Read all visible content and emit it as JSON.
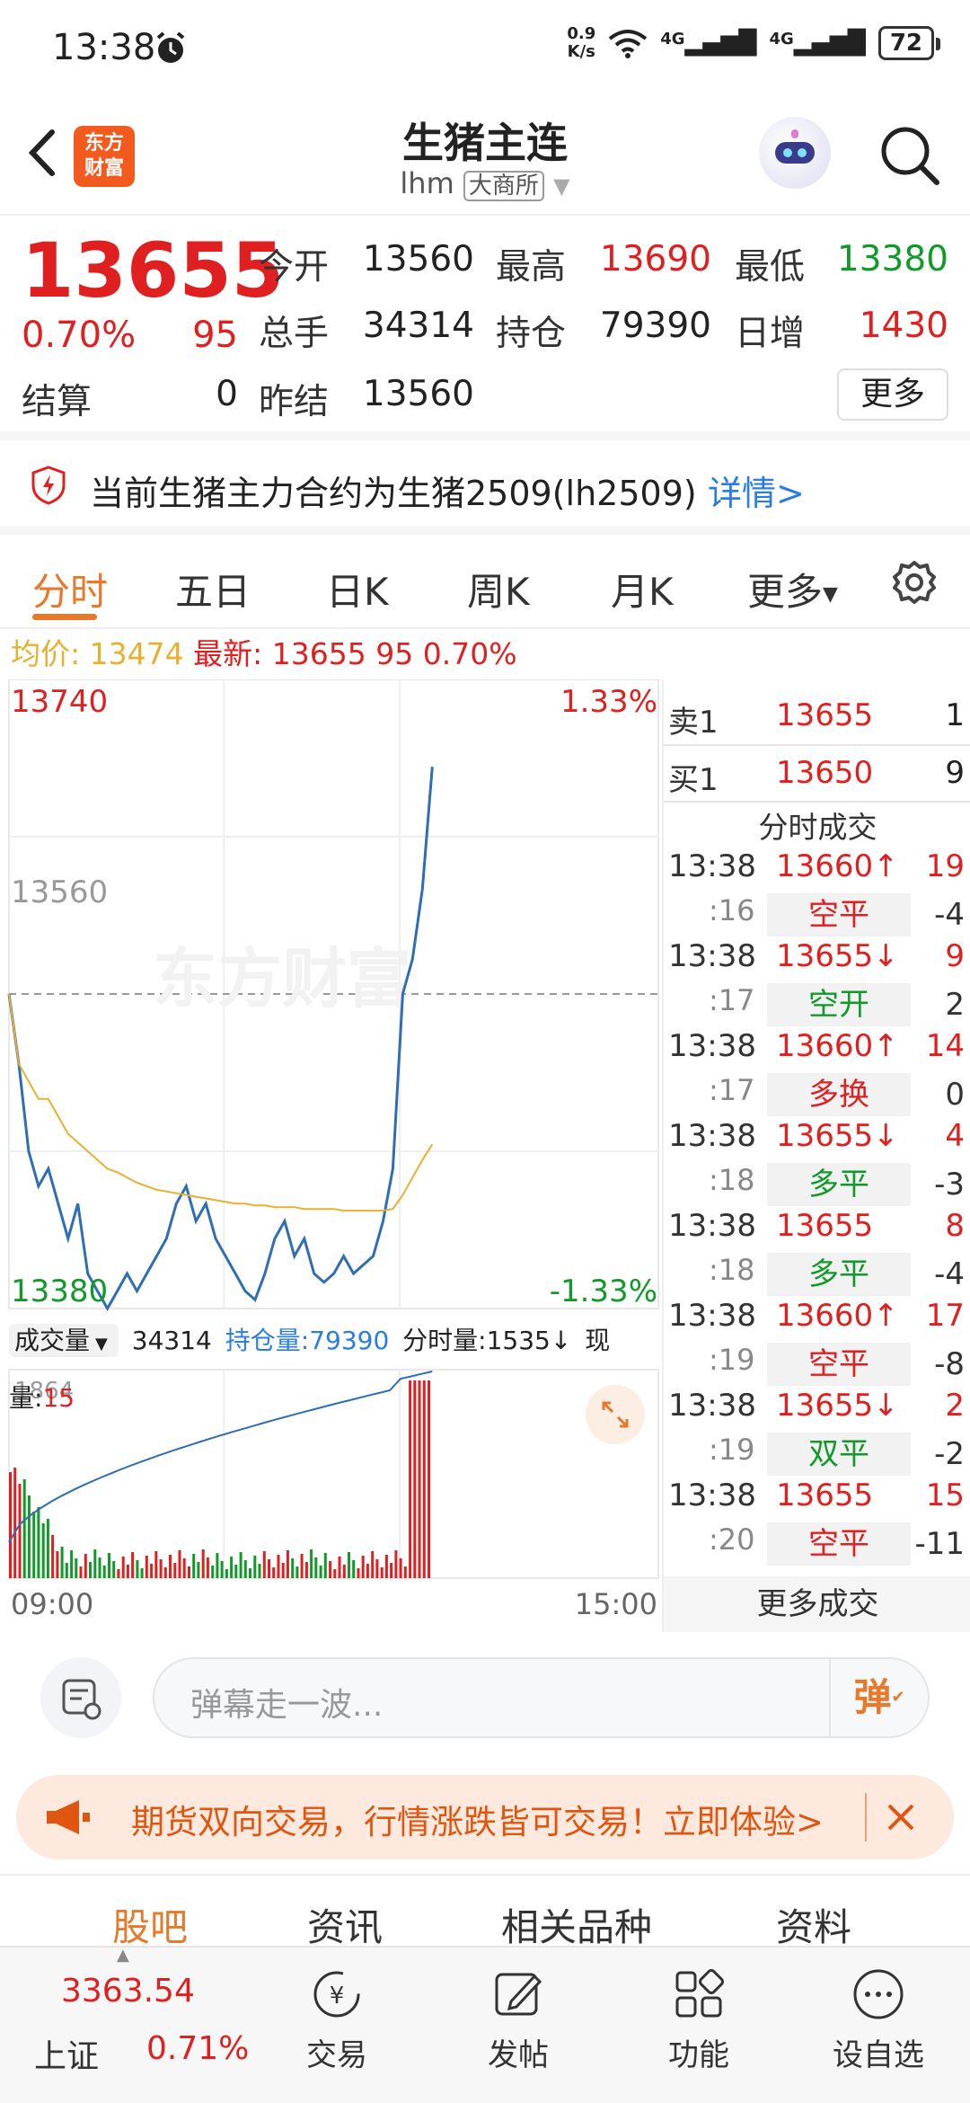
{
  "status": {
    "time": "13:38",
    "net_speed_top": "0.9",
    "net_speed_bottom": "K/s",
    "signal1": "4G",
    "signal2": "4G",
    "battery": "72"
  },
  "nav": {
    "title": "生猪主连",
    "code": "lhm",
    "exchange": "大商所",
    "logo_line1": "东方",
    "logo_line2": "财富"
  },
  "quote": {
    "last": "13655",
    "change_pct": "0.70%",
    "change_abs": "95",
    "open_label": "今开",
    "open": "13560",
    "high_label": "最高",
    "high": "13690",
    "low_label": "最低",
    "low": "13380",
    "volume_label": "总手",
    "volume": "34314",
    "oi_label": "持仓",
    "oi": "79390",
    "daily_inc_label": "日增",
    "daily_inc": "1430",
    "settle_label": "结算",
    "settle": "0",
    "prev_settle_label": "昨结",
    "prev_settle": "13560",
    "more": "更多"
  },
  "notice": {
    "text": "当前生猪主力合约为生猪2509(lh2509)",
    "link": "详情>"
  },
  "tabs": [
    "分时",
    "五日",
    "日K",
    "周K",
    "月K",
    "更多"
  ],
  "info_line": {
    "avg_label": "均价:",
    "avg": "13474",
    "latest_label": "最新:",
    "latest": "13655",
    "chg": "95",
    "pct": "0.70%"
  },
  "chart": {
    "watermark": "东方财富",
    "y_top": "13740",
    "y_mid": "13560",
    "y_bottom": "13380",
    "pct_top": "1.33%",
    "pct_bottom": "-1.33%",
    "vol_max": "1864",
    "x_start": "09:00",
    "x_end": "15:00"
  },
  "chart_data": {
    "type": "line",
    "title": "",
    "xlabel": "",
    "ylabel": "",
    "x_range": [
      "09:00",
      "15:00"
    ],
    "ylim": [
      13380,
      13740
    ],
    "reference": 13560,
    "series": [
      {
        "name": "",
        "color": "#2f6db5",
        "values": [
          13560,
          13520,
          13470,
          13450,
          13460,
          13440,
          13420,
          13440,
          13400,
          13390,
          13380,
          13390,
          13400,
          13390,
          13400,
          13410,
          13420,
          13440,
          13450,
          13430,
          13440,
          13420,
          13410,
          13400,
          13390,
          13385,
          13400,
          13420,
          13430,
          13410,
          13420,
          13400,
          13395,
          13400,
          13410,
          13400,
          13405,
          13410,
          13430,
          13460,
          13560,
          13580,
          13620,
          13690
        ]
      },
      {
        "name": "",
        "color": "#e8b030",
        "values": [
          13560,
          13520,
          13510,
          13500,
          13500,
          13490,
          13480,
          13475,
          13470,
          13465,
          13460,
          13458,
          13455,
          13452,
          13450,
          13448,
          13447,
          13446,
          13445,
          13444,
          13443,
          13442,
          13441,
          13440,
          13440,
          13439,
          13439,
          13438,
          13438,
          13438,
          13437,
          13437,
          13437,
          13437,
          13436,
          13436,
          13436,
          13436,
          13436,
          13437,
          13445,
          13455,
          13465,
          13474
        ]
      }
    ]
  },
  "vol_info": {
    "label": "成交量",
    "vol": "34314",
    "oi_label": "持仓量:",
    "oi": "79390",
    "tick_vol_label": "分时量:",
    "tick_vol": "1535↓",
    "cur_label": "现量:",
    "cur": "15"
  },
  "book": {
    "ask_label": "卖1",
    "ask_price": "13655",
    "ask_qty": "1",
    "bid_label": "买1",
    "bid_price": "13650",
    "bid_qty": "9",
    "ticks_title": "分时成交",
    "ticks": [
      {
        "time": "13:38",
        "price": "13660↑",
        "qty": "19",
        "pcolor": "red",
        "sec": ":16",
        "kind": "空平",
        "kcolor": "red",
        "delta": "-4"
      },
      {
        "time": "13:38",
        "price": "13655↓",
        "qty": "9",
        "pcolor": "red",
        "sec": ":17",
        "kind": "空开",
        "kcolor": "green",
        "delta": "2"
      },
      {
        "time": "13:38",
        "price": "13660↑",
        "qty": "14",
        "pcolor": "red",
        "sec": ":17",
        "kind": "多换",
        "kcolor": "red",
        "delta": "0"
      },
      {
        "time": "13:38",
        "price": "13655↓",
        "qty": "4",
        "pcolor": "red",
        "sec": ":18",
        "kind": "多平",
        "kcolor": "green",
        "delta": "-3"
      },
      {
        "time": "13:38",
        "price": "13655",
        "qty": "8",
        "pcolor": "red",
        "sec": ":18",
        "kind": "多平",
        "kcolor": "green",
        "delta": "-4"
      },
      {
        "time": "13:38",
        "price": "13660↑",
        "qty": "17",
        "pcolor": "red",
        "sec": ":19",
        "kind": "空平",
        "kcolor": "red",
        "delta": "-8"
      },
      {
        "time": "13:38",
        "price": "13655↓",
        "qty": "2",
        "pcolor": "red",
        "sec": ":19",
        "kind": "双平",
        "kcolor": "green",
        "delta": "-2"
      },
      {
        "time": "13:38",
        "price": "13655",
        "qty": "15",
        "pcolor": "red",
        "sec": ":20",
        "kind": "空平",
        "kcolor": "red",
        "delta": "-11"
      }
    ],
    "more_ticks": "更多成交"
  },
  "comment": {
    "placeholder": "弹幕走一波...",
    "danmu": "弹"
  },
  "banner": {
    "text": "期货双向交易，行情涨跌皆可交易！立即体验>"
  },
  "sub_tabs": [
    "股吧",
    "资讯",
    "相关品种",
    "资料"
  ],
  "bottom": {
    "index_value": "3363.54",
    "index_name": "上证",
    "index_pct": "0.71%",
    "items": [
      "交易",
      "发帖",
      "功能",
      "设自选"
    ]
  },
  "colors": {
    "up": "#e02020",
    "down": "#119a2a",
    "accent": "#e8792a",
    "price_line": "#2f6db5",
    "avg_line": "#e8b030"
  }
}
